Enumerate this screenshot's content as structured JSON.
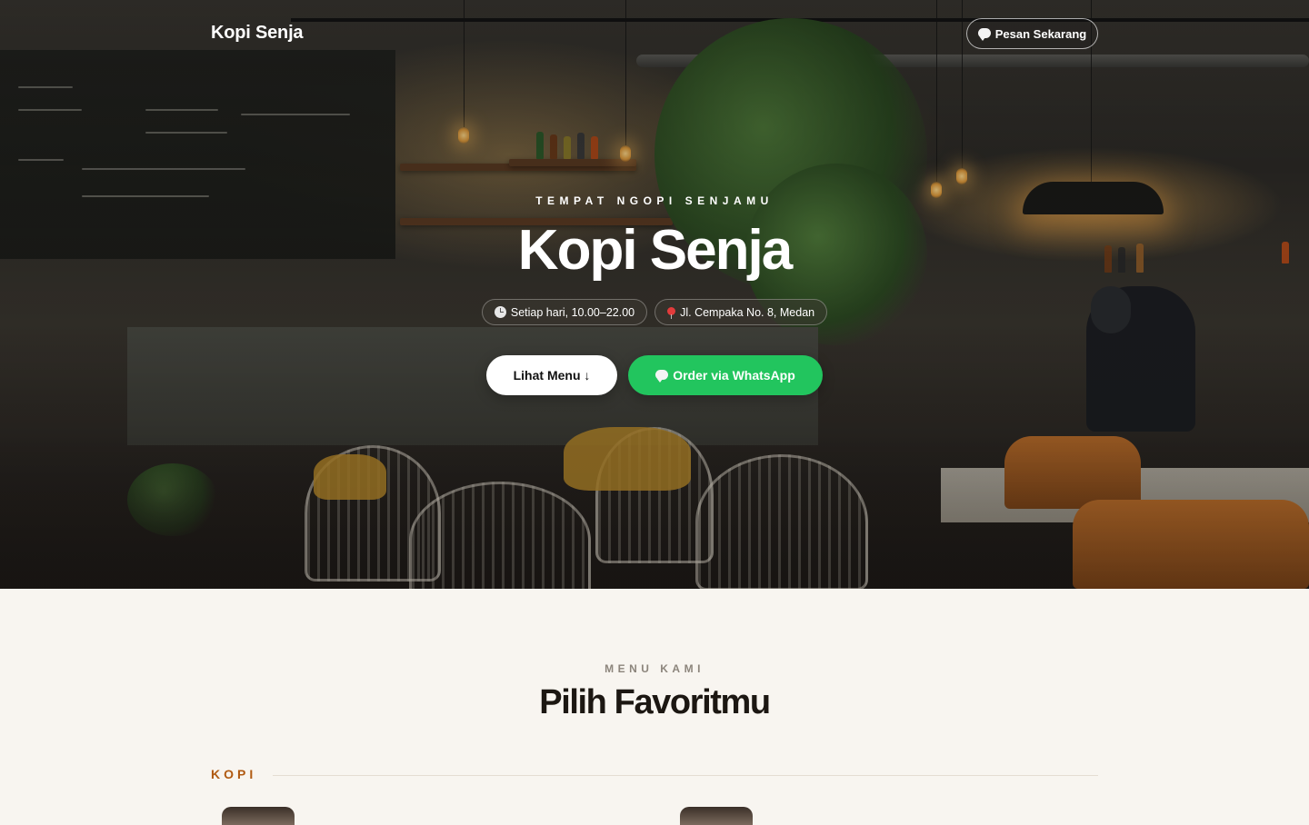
{
  "nav": {
    "brand": "Kopi Senja",
    "cta_label": "Pesan Sekarang",
    "cta_icon": "speech-bubble-icon"
  },
  "hero": {
    "eyebrow": "TEMPAT NGOPI SENJAMU",
    "title": "Kopi Senja",
    "info_pills": [
      {
        "icon": "clock-icon",
        "text": "Setiap hari, 10.00–22.00"
      },
      {
        "icon": "pin-icon",
        "text": "Jl. Cempaka No. 8, Medan"
      }
    ],
    "primary_button": "Lihat Menu ↓",
    "whatsapp_button": "Order via WhatsApp"
  },
  "menu": {
    "eyebrow": "MENU KAMI",
    "title": "Pilih Favoritmu",
    "category": "KOPI"
  },
  "colors": {
    "accent_green": "#22c55e",
    "category_orange": "#b05a12",
    "page_background": "#f8f5f0"
  }
}
